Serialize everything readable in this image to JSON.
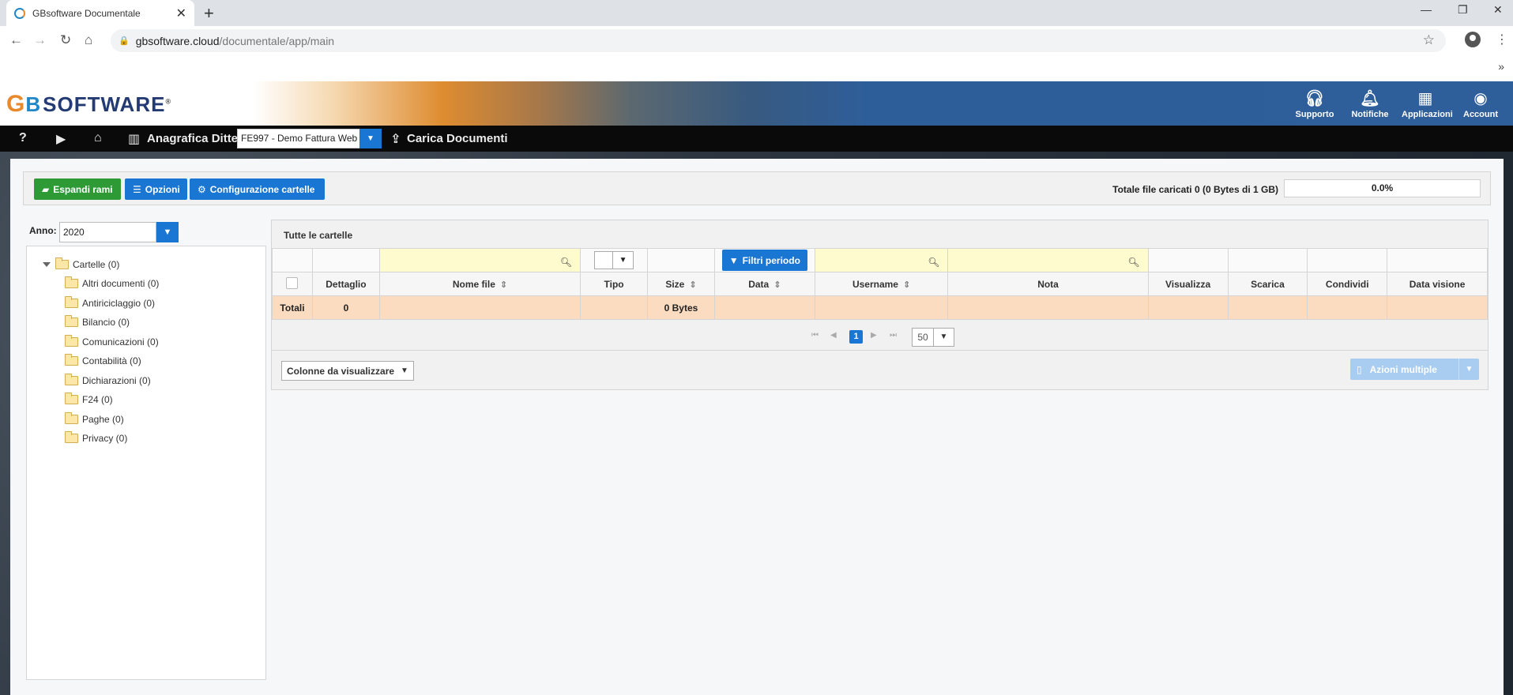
{
  "browser": {
    "tab_title": "GBsoftware Documentale",
    "url_host": "gbsoftware.cloud",
    "url_path": "/documentale/app/main"
  },
  "header": {
    "logo_text": "GBSOFTWARE",
    "buttons": [
      {
        "label": "Supporto",
        "icon": "headset-icon"
      },
      {
        "label": "Notifiche",
        "icon": "bell-icon"
      },
      {
        "label": "Applicazioni",
        "icon": "grid-icon"
      },
      {
        "label": "Account",
        "icon": "user-circle-icon"
      }
    ]
  },
  "toolbar": {
    "help": "?",
    "anagrafica_label": "Anagrafica Ditte",
    "ditta_selected": "FE997 - Demo Fattura Web",
    "carica_label": "Carica Documenti"
  },
  "actions": {
    "espandi": "Espandi rami",
    "opzioni": "Opzioni",
    "configurazione": "Configurazione cartelle",
    "totale_label": "Totale file caricati 0 (0 Bytes di 1 GB)",
    "usage_percent": "0.0%",
    "usage_fraction": 0.0
  },
  "sidebar": {
    "anno_label": "Anno:",
    "anno_value": "2020",
    "root": "Cartelle (0)",
    "folders": [
      "Altri documenti (0)",
      "Antiriciclaggio (0)",
      "Bilancio (0)",
      "Comunicazioni (0)",
      "Contabilità (0)",
      "Dichiarazioni (0)",
      "F24 (0)",
      "Paghe (0)",
      "Privacy (0)"
    ]
  },
  "grid": {
    "title": "Tutte le cartelle",
    "filtri_label": "Filtri periodo",
    "columns": [
      "Dettaglio",
      "Nome file",
      "Tipo",
      "Size",
      "Data",
      "Username",
      "Nota",
      "Visualizza",
      "Scarica",
      "Condividi",
      "Data visione"
    ],
    "totals": {
      "label": "Totali",
      "dettaglio": "0",
      "size": "0 Bytes"
    },
    "pager": {
      "current_page": "1",
      "page_size": "50"
    },
    "colonne_label": "Colonne da visualizzare",
    "azioni_label": "Azioni multiple"
  },
  "colors": {
    "primary": "#1976d2",
    "success": "#2e9a36",
    "totals_row": "#fbdcc0",
    "filter_highlight": "#fefccf"
  }
}
